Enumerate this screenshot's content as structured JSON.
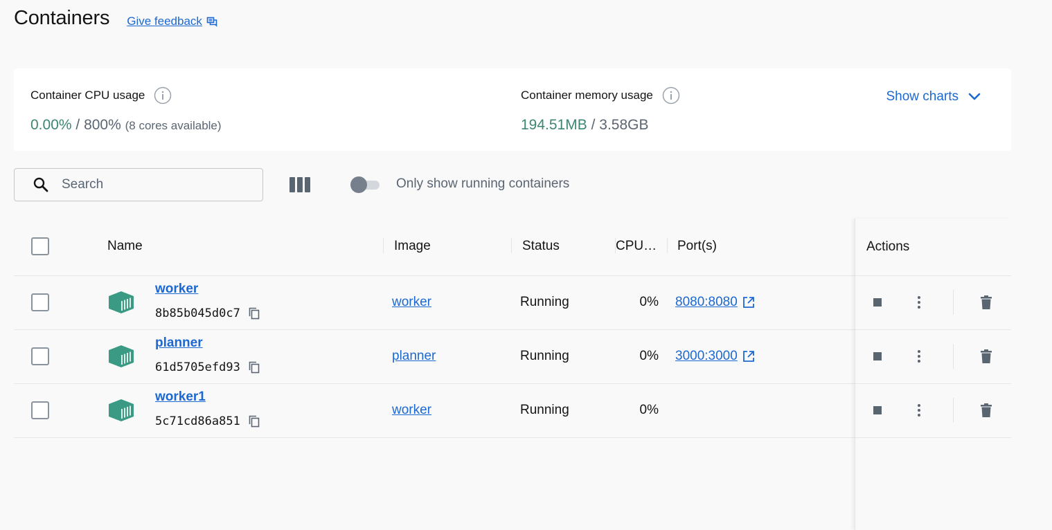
{
  "header": {
    "title": "Containers",
    "feedback_label": "Give feedback"
  },
  "stats": {
    "cpu_label": "Container CPU usage",
    "cpu_used": "0.00%",
    "cpu_sep": "/",
    "cpu_total": "800%",
    "cpu_note": "(8 cores available)",
    "mem_label": "Container memory usage",
    "mem_used": "194.51MB",
    "mem_sep": "/",
    "mem_total": "3.58GB",
    "show_charts": "Show charts"
  },
  "toolbar": {
    "search_placeholder": "Search",
    "toggle_label": "Only show running containers",
    "toggle_on": false
  },
  "table": {
    "headers": {
      "name": "Name",
      "image": "Image",
      "status": "Status",
      "cpu": "CPU…",
      "ports": "Port(s)",
      "actions": "Actions"
    },
    "rows": [
      {
        "name": "worker",
        "id": "8b85b045d0c7",
        "image": "worker",
        "status": "Running",
        "cpu": "0%",
        "port": "8080:8080"
      },
      {
        "name": "planner",
        "id": "61d5705efd93",
        "image": "planner",
        "status": "Running",
        "cpu": "0%",
        "port": "3000:3000"
      },
      {
        "name": "worker1",
        "id": "5c71cd86a851",
        "image": "worker",
        "status": "Running",
        "cpu": "0%",
        "port": ""
      }
    ]
  },
  "colors": {
    "accent": "#1c68d1",
    "container_icon": "#3a9a83",
    "usage_green": "#3c8673",
    "muted": "#5a6572"
  },
  "icons": [
    "feedback-icon",
    "info-icon",
    "chevron-down-icon",
    "search-icon",
    "columns-icon",
    "container-icon",
    "copy-icon",
    "external-link-icon",
    "stop-icon",
    "more-vertical-icon",
    "trash-icon"
  ]
}
